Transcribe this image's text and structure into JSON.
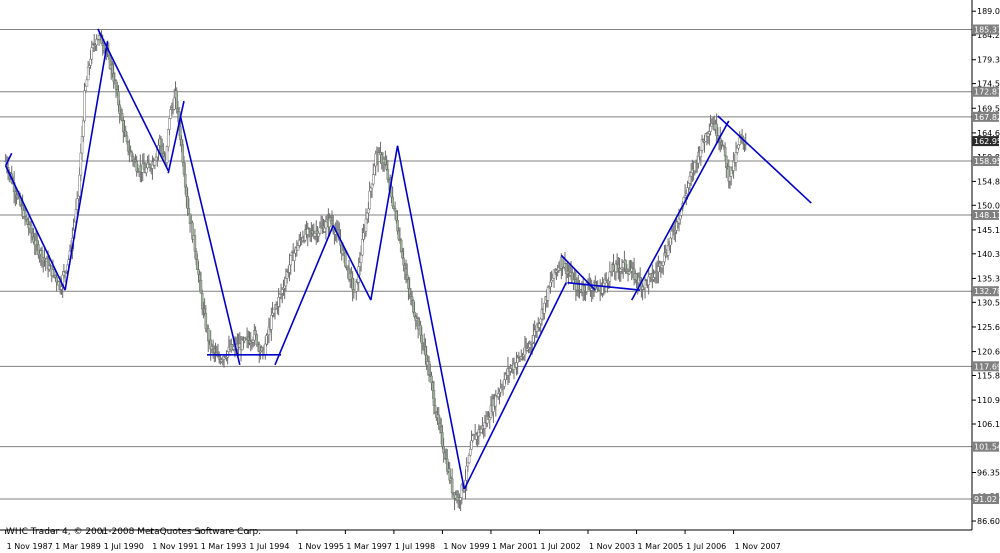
{
  "copyright": "WHC Trader 4, © 2001-2008 MetaQuotes Software Corp.",
  "colors": {
    "background": "#ffffff",
    "grid": "#000000",
    "level_line": "#808080",
    "level_label_bg": "#808080",
    "current_label_bg": "#2b2b2b",
    "bar": "#6b6b6b",
    "candle_bull": "#ffffff",
    "candle_bear": "#9fb89a",
    "trendline": "#0000cc"
  },
  "chart_data": {
    "type": "candlestick",
    "ylim": [
      85.6,
      190.5
    ],
    "y_ticks": [
      86.6,
      91.55,
      96.35,
      101.15,
      106.1,
      110.9,
      115.85,
      120.65,
      125.6,
      130.55,
      135.35,
      140.3,
      145.1,
      150.05,
      154.85,
      159.8,
      164.6,
      169.55,
      174.5,
      179.3,
      184.25,
      189.05
    ],
    "y_tick_labels": [
      "86.60",
      "91.55",
      "96.35",
      "101.15",
      "106.10",
      "110.90",
      "115.85",
      "120.65",
      "125.60",
      "130.55",
      "135.35",
      "140.30",
      "145.10",
      "150.05",
      "154.85",
      "159.80",
      "164.60",
      "169.55",
      "174.50",
      "179.30",
      "184.25",
      "189.05"
    ],
    "x_ticks": [
      0,
      40,
      80,
      120,
      160,
      200,
      240,
      280,
      320,
      360,
      400,
      440,
      480,
      520,
      560,
      600
    ],
    "x_tick_labels": [
      "1 Nov 1987",
      "1 Mar 1989",
      "1 Jul 1990",
      "1 Nov 1991",
      "1 Mar 1993",
      "1 Jul 1994",
      "1 Nov 1995",
      "1 Mar 1997",
      "1 Jul 1998",
      "1 Nov 1999",
      "1 Mar 2001",
      "1 Jul 2002",
      "1 Nov 2003",
      "1 Mar 2005",
      "1 Jul 2006",
      "1 Nov 2007"
    ],
    "xlim": [
      -3,
      780
    ],
    "current_price": 162.95,
    "current_price_label": "162.95",
    "levels": [
      {
        "value": 185.37,
        "label": "185.37"
      },
      {
        "value": 172.87,
        "label": "172.87"
      },
      {
        "value": 167.82,
        "label": "167.82"
      },
      {
        "value": 158.95,
        "label": "158.95"
      },
      {
        "value": 148.11,
        "label": "148.11"
      },
      {
        "value": 132.78,
        "label": "132.78"
      },
      {
        "value": 117.69,
        "label": "117.69"
      },
      {
        "value": 101.54,
        "label": "101.54"
      },
      {
        "value": 91.02,
        "label": "91.02"
      }
    ],
    "price_path": [
      [
        0,
        159
      ],
      [
        12,
        150
      ],
      [
        25,
        142
      ],
      [
        45,
        134
      ],
      [
        53,
        140
      ],
      [
        60,
        152
      ],
      [
        65,
        172
      ],
      [
        70,
        180
      ],
      [
        75,
        184
      ],
      [
        80,
        183
      ],
      [
        88,
        177
      ],
      [
        95,
        168
      ],
      [
        100,
        162
      ],
      [
        108,
        158
      ],
      [
        115,
        157
      ],
      [
        122,
        159
      ],
      [
        127,
        163
      ],
      [
        132,
        158
      ],
      [
        135,
        168
      ],
      [
        140,
        172
      ],
      [
        145,
        162
      ],
      [
        150,
        150
      ],
      [
        157,
        140
      ],
      [
        162,
        130
      ],
      [
        168,
        122
      ],
      [
        175,
        119
      ],
      [
        185,
        121
      ],
      [
        195,
        122
      ],
      [
        205,
        124
      ],
      [
        212,
        120
      ],
      [
        220,
        128
      ],
      [
        228,
        133
      ],
      [
        235,
        139
      ],
      [
        245,
        144
      ],
      [
        258,
        145
      ],
      [
        268,
        147
      ],
      [
        275,
        143
      ],
      [
        282,
        137
      ],
      [
        288,
        132
      ],
      [
        295,
        144
      ],
      [
        305,
        160
      ],
      [
        312,
        159
      ],
      [
        318,
        152
      ],
      [
        325,
        143
      ],
      [
        332,
        133
      ],
      [
        340,
        126
      ],
      [
        348,
        118
      ],
      [
        355,
        108
      ],
      [
        362,
        100
      ],
      [
        368,
        93
      ],
      [
        373,
        91
      ],
      [
        378,
        94
      ],
      [
        385,
        103
      ],
      [
        395,
        106
      ],
      [
        405,
        112
      ],
      [
        415,
        117
      ],
      [
        430,
        121
      ],
      [
        440,
        127
      ],
      [
        450,
        135
      ],
      [
        458,
        139
      ],
      [
        465,
        136
      ],
      [
        472,
        133
      ],
      [
        480,
        134
      ],
      [
        490,
        133
      ],
      [
        500,
        137
      ],
      [
        510,
        138
      ],
      [
        518,
        136
      ],
      [
        525,
        134
      ],
      [
        535,
        136
      ],
      [
        545,
        141
      ],
      [
        555,
        148
      ],
      [
        565,
        156
      ],
      [
        575,
        163
      ],
      [
        582,
        167
      ],
      [
        590,
        163
      ],
      [
        596,
        156
      ],
      [
        600,
        158
      ],
      [
        605,
        163
      ],
      [
        610,
        162.95
      ]
    ],
    "trendlines": [
      [
        0,
        158,
        5,
        160.5
      ],
      [
        0,
        158,
        49,
        133
      ],
      [
        49,
        133,
        84,
        183
      ],
      [
        76,
        185.5,
        134,
        157
      ],
      [
        134,
        156.5,
        147,
        171
      ],
      [
        144,
        168,
        193,
        118
      ],
      [
        166,
        120,
        227,
        120
      ],
      [
        222,
        118,
        270,
        146
      ],
      [
        270,
        146,
        301,
        131
      ],
      [
        301,
        131,
        323,
        162
      ],
      [
        323,
        162,
        378,
        93
      ],
      [
        378,
        93,
        462,
        134.5
      ],
      [
        458,
        140,
        486,
        133
      ],
      [
        463,
        134.5,
        523,
        133
      ],
      [
        516,
        131,
        596,
        167
      ],
      [
        587,
        168,
        664,
        150.5
      ]
    ]
  }
}
